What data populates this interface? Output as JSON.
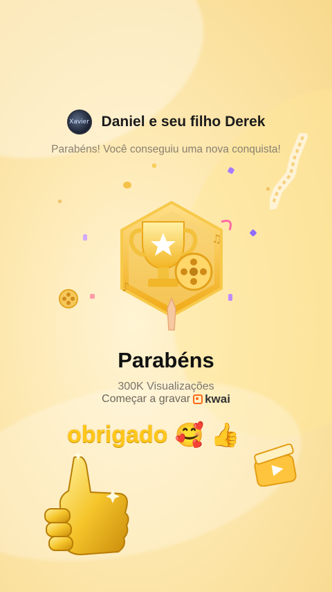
{
  "header": {
    "author": "Daniel e seu filho Derek",
    "avatar_text": "Xavier"
  },
  "subtitle": "Parabéns! Você conseguiu uma nova conquista!",
  "achievement": {
    "title": "Parabéns",
    "views": "300K Visualizações",
    "record_label": "Começar a gravar",
    "brand": "kwai"
  },
  "overlay": {
    "thanks_text": "obrigado",
    "emoji_1": "🥰",
    "emoji_2": "👍"
  },
  "colors": {
    "gold": "#f5b71a",
    "accent": "#ffc71a",
    "brand_orange": "#ff6a1a"
  }
}
